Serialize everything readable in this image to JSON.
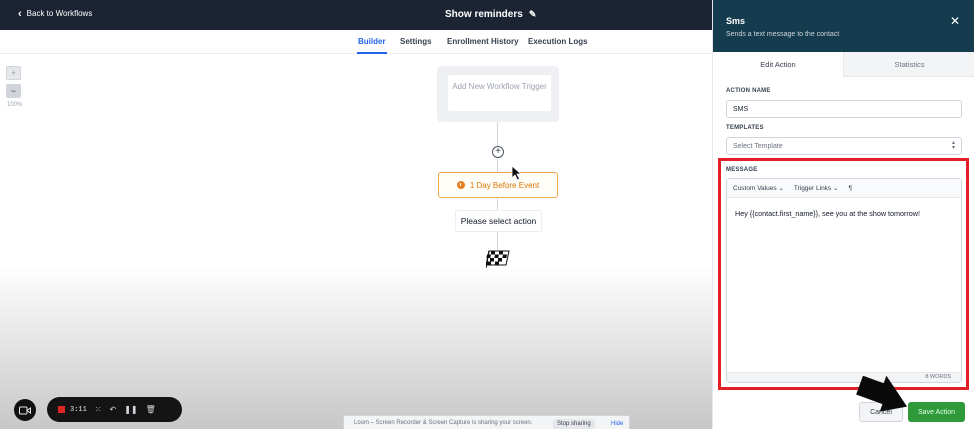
{
  "topbar": {
    "back_label": "Back to Workflows",
    "title": "Show reminders"
  },
  "tabs": [
    {
      "label": "Builder",
      "active": true
    },
    {
      "label": "Settings",
      "active": false
    },
    {
      "label": "Enrollment History",
      "active": false
    },
    {
      "label": "Execution Logs",
      "active": false
    }
  ],
  "zoom": {
    "plus": "+",
    "minus": "−",
    "level": "100%"
  },
  "canvas": {
    "trigger_label": "Add New Workflow Trigger",
    "event_label": "1 Day Before Event",
    "select_action_label": "Please select action"
  },
  "recorder": {
    "time": "3:11"
  },
  "loom": {
    "message": "Loom – Screen Recorder & Screen Capture is sharing your screen.",
    "stop_label": "Stop sharing",
    "hide_label": "Hide"
  },
  "panel": {
    "title": "Sms",
    "subtitle": "Sends a text message to the contact",
    "tabs": [
      "Edit Action",
      "Statistics"
    ],
    "action_name_label": "ACTION NAME",
    "action_name_value": "SMS",
    "templates_label": "TEMPLATES",
    "templates_placeholder": "Select Template",
    "message_label": "MESSAGE",
    "toolbar": {
      "custom_values": "Custom Values",
      "trigger_links": "Trigger Links",
      "paragraph": "¶"
    },
    "message_text": "Hey {{contact.first_name}}, see you at the show tomorrow!",
    "word_count": "8 WORDS",
    "cancel_label": "Cancel",
    "save_label": "Save Action"
  },
  "colors": {
    "accent": "#2563eb",
    "header": "#1c2434",
    "panel_header": "#153b4f",
    "highlight": "#e3202a",
    "save": "#2f9a3c",
    "event": "#d97706"
  }
}
